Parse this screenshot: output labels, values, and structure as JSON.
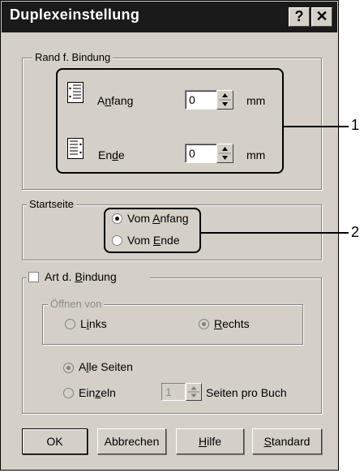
{
  "dialog": {
    "title": "Duplexeinstellung",
    "help_icon": "?",
    "close_icon": "✕"
  },
  "binding_margin": {
    "group_label": "Rand f. Bindung",
    "start": {
      "label_pre": "A",
      "label_ul": "n",
      "label_post": "fang",
      "value": "0",
      "unit": "mm"
    },
    "end": {
      "label_pre": "En",
      "label_ul": "d",
      "label_post": "e",
      "value": "0",
      "unit": "mm"
    }
  },
  "start_page": {
    "group_label": "Startseite",
    "options": [
      {
        "pre": "Vom ",
        "ul": "A",
        "post": "nfang",
        "selected": true
      },
      {
        "pre": "Vom ",
        "ul": "E",
        "post": "nde",
        "selected": false
      }
    ]
  },
  "binding_type": {
    "checkbox_pre": "Art d. ",
    "checkbox_ul": "B",
    "checkbox_post": "indung",
    "checked": false,
    "open_from": {
      "group_label": "Öffnen von",
      "left": {
        "pre": "L",
        "ul": "i",
        "post": "nks",
        "selected": false
      },
      "right": {
        "pre": "",
        "ul": "R",
        "post": "echts",
        "selected": true
      }
    },
    "all_pages": {
      "pre": "A",
      "ul": "l",
      "post": "le Seiten",
      "selected": true
    },
    "single": {
      "pre": "Ein",
      "ul": "z",
      "post": "eln",
      "selected": false
    },
    "pages_value": "1",
    "pages_label": "Seiten pro Buch"
  },
  "buttons": {
    "ok": "OK",
    "cancel": "Abbrechen",
    "help_pre": "",
    "help_ul": "H",
    "help_post": "ilfe",
    "standard_pre": "",
    "standard_ul": "S",
    "standard_post": "tandard"
  },
  "callouts": {
    "one": "1",
    "two": "2"
  }
}
